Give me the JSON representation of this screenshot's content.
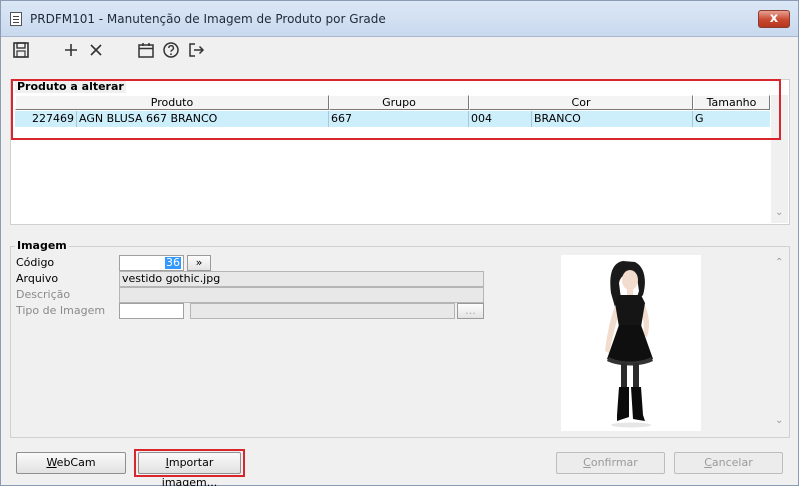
{
  "window": {
    "title": "PRDFM101 - Manutenção de Imagem de Produto por Grade",
    "close_label": "x"
  },
  "toolbar": {
    "icons": [
      "save-icon",
      "add-icon",
      "delete-icon",
      "calendar-icon",
      "help-icon",
      "exit-icon"
    ]
  },
  "produto_group": {
    "label": "Produto a alterar",
    "columns": [
      "Produto",
      "Grupo",
      "Cor",
      "Tamanho"
    ],
    "row": {
      "codigo": "227469",
      "descricao": "AGN BLUSA 667 BRANCO",
      "grupo": "667",
      "cor_codigo": "004",
      "cor_nome": "BRANCO",
      "tamanho": "G"
    }
  },
  "imagem_group": {
    "label": "Imagem",
    "codigo_label": "Código",
    "codigo_value": "36",
    "lookup_button": "»",
    "arquivo_label": "Arquivo",
    "arquivo_value": "vestido gothic.jpg",
    "descricao_label": "Descrição",
    "descricao_value": "",
    "tipo_label": "Tipo de Imagem",
    "tipo_value": "",
    "tipo_button": "..."
  },
  "buttons": {
    "webcam": "WebCam",
    "webcam_rest": "ebCam",
    "webcam_key": "W",
    "importar_key": "I",
    "importar_rest": "mportar imagem...",
    "confirmar_key": "C",
    "confirmar_rest": "onfirmar",
    "cancelar_key": "C",
    "cancelar_rest": "ancelar"
  },
  "colors": {
    "selection_row": "#cdeefb",
    "highlight": "#d9262c",
    "title_bar": "#dbe7f6"
  }
}
